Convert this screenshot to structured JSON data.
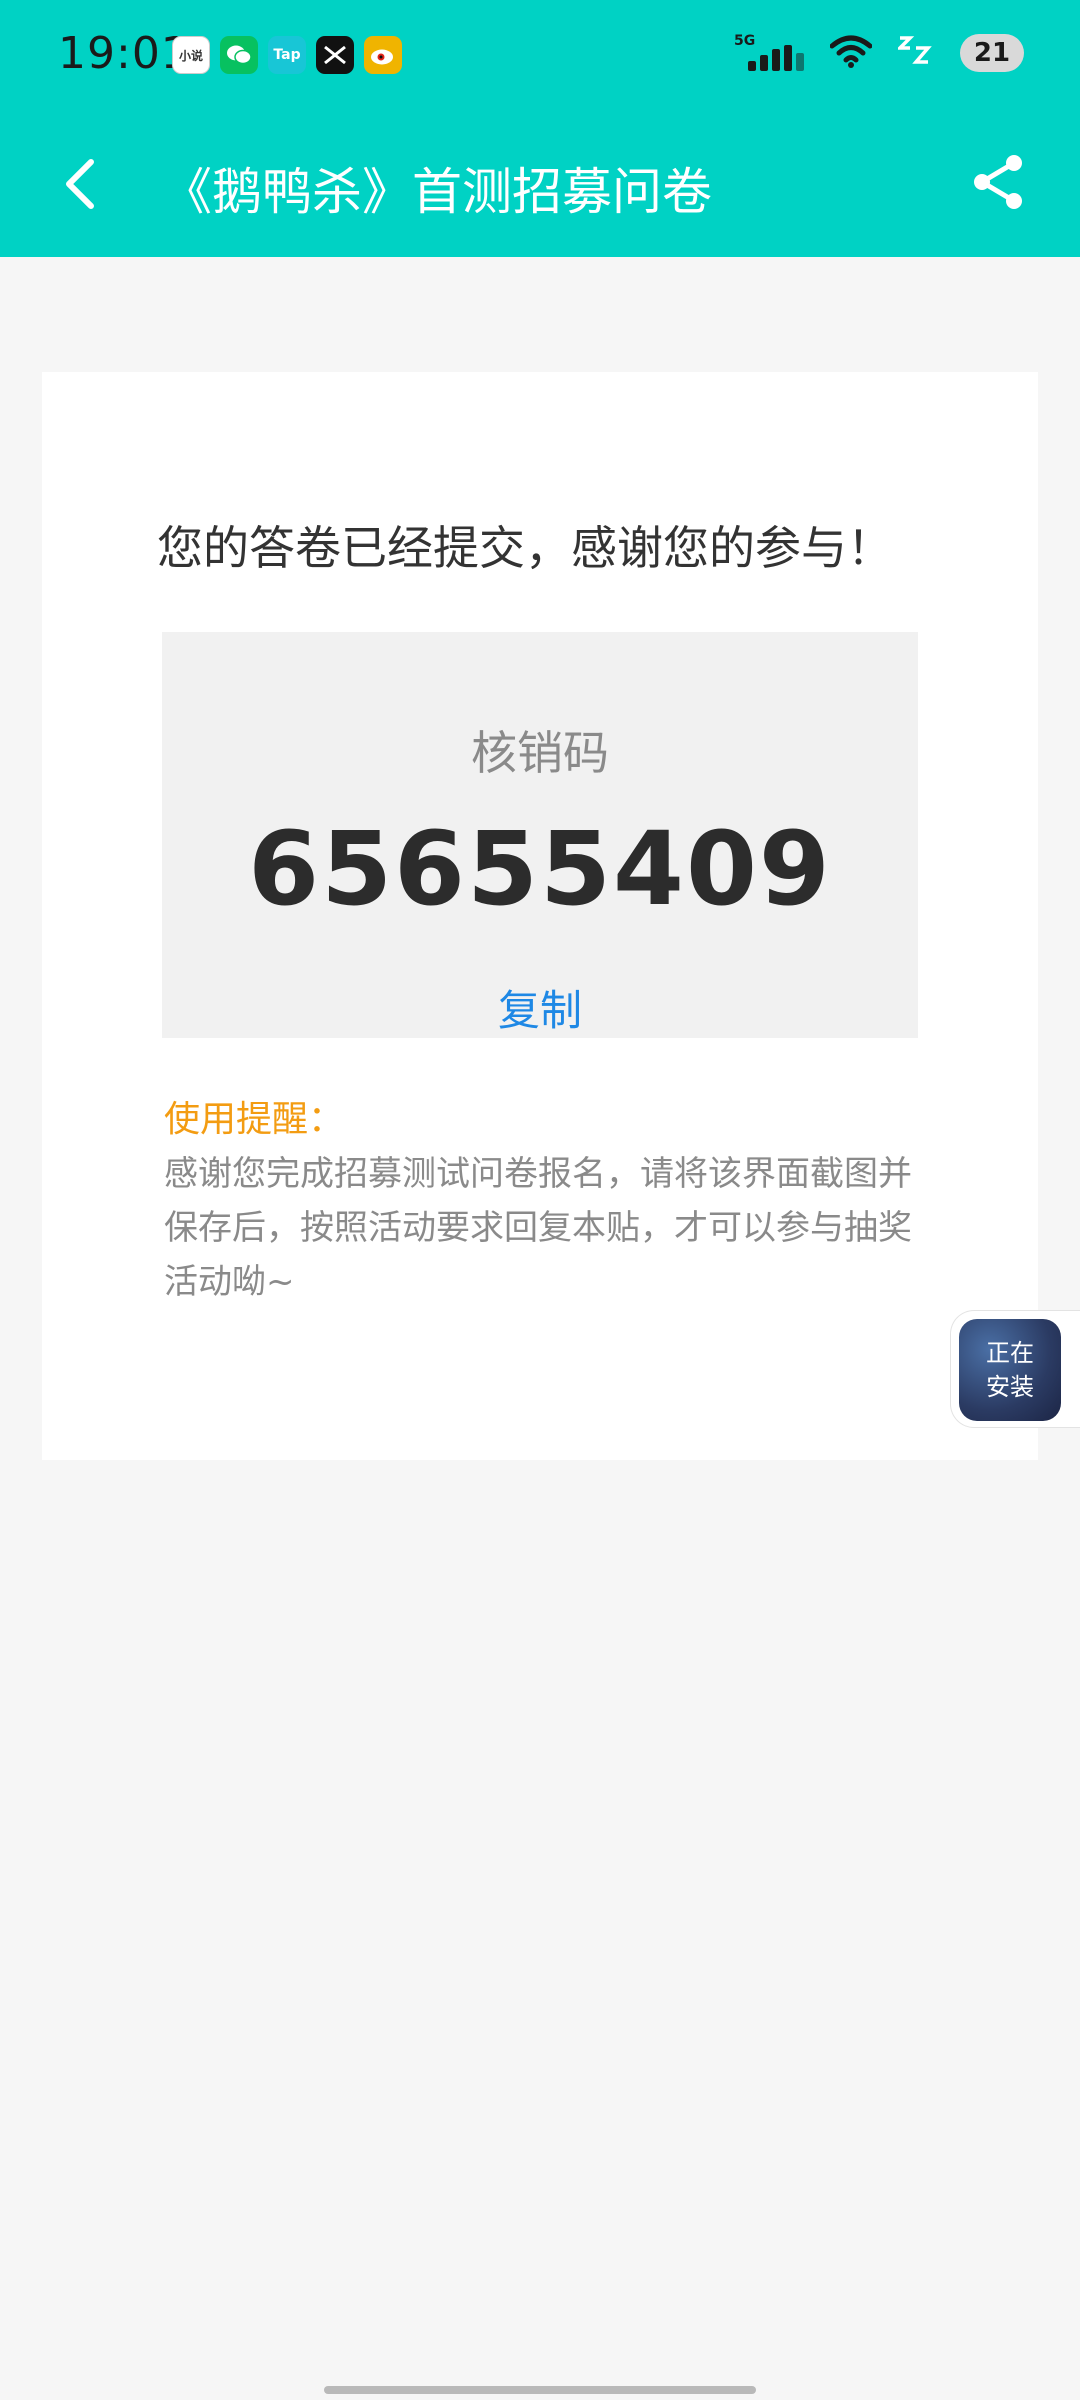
{
  "status_bar": {
    "time": "19:01",
    "notifications": [
      {
        "icon": "novel-app-icon",
        "label": "小说",
        "color": "#ffffff"
      },
      {
        "icon": "wechat-icon",
        "label": "",
        "color": "#07c160"
      },
      {
        "icon": "taptap-icon",
        "label": "Tap",
        "color": "#18c6d6"
      },
      {
        "icon": "capcut-icon",
        "label": "",
        "color": "#111111"
      },
      {
        "icon": "weibo-icon",
        "label": "",
        "color": "#f0b400"
      }
    ],
    "network": "5G",
    "battery": "21"
  },
  "nav": {
    "title": "《鹅鸭杀》首测招募问卷"
  },
  "card": {
    "headline": "您的答卷已经提交，感谢您的参与！",
    "code_label": "核销码",
    "code_value": "65655409",
    "copy_label": "复制",
    "reminder_title": "使用提醒：",
    "reminder_body": "感谢您完成招募测试问卷报名，请将该界面截图并保存后，按照活动要求回复本贴，才可以参与抽奖活动呦~"
  },
  "floating": {
    "install_label": "正在安装"
  },
  "colors": {
    "header": "#00d2c4",
    "link": "#1e88e5",
    "reminder": "#f39c12"
  }
}
